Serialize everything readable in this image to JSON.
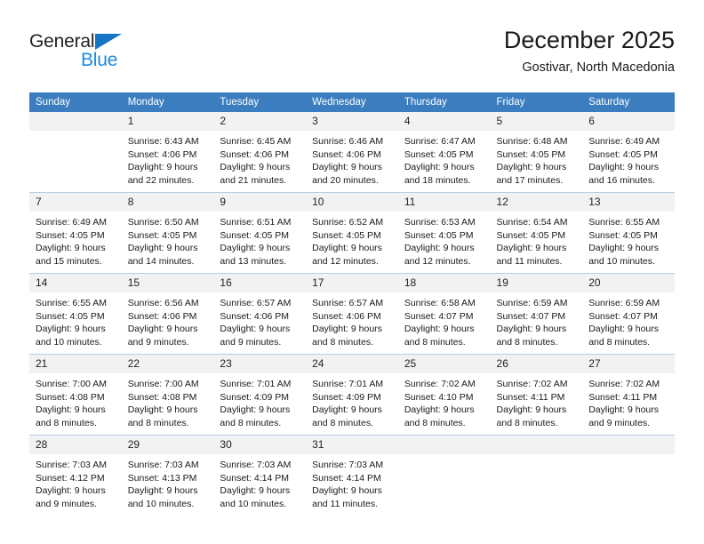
{
  "brand": {
    "name_top": "General",
    "name_bottom": "Blue",
    "accent_color": "#1b8ae0",
    "triangle_color": "#1574c4",
    "triangle_icon": "triangle-icon"
  },
  "header": {
    "title": "December 2025",
    "subtitle": "Gostivar, North Macedonia"
  },
  "calendar": {
    "header_background": "#3b7dbf",
    "daynum_background": "#f2f2f2",
    "grid_line_color": "#b7cde2",
    "weekdays": [
      "Sunday",
      "Monday",
      "Tuesday",
      "Wednesday",
      "Thursday",
      "Friday",
      "Saturday"
    ],
    "weeks": [
      [
        {
          "day": "",
          "empty": true,
          "sunrise": "",
          "sunset": "",
          "daylight_line1": "",
          "daylight_line2": ""
        },
        {
          "day": "1",
          "empty": false,
          "sunrise": "Sunrise: 6:43 AM",
          "sunset": "Sunset: 4:06 PM",
          "daylight_line1": "Daylight: 9 hours",
          "daylight_line2": "and 22 minutes."
        },
        {
          "day": "2",
          "empty": false,
          "sunrise": "Sunrise: 6:45 AM",
          "sunset": "Sunset: 4:06 PM",
          "daylight_line1": "Daylight: 9 hours",
          "daylight_line2": "and 21 minutes."
        },
        {
          "day": "3",
          "empty": false,
          "sunrise": "Sunrise: 6:46 AM",
          "sunset": "Sunset: 4:06 PM",
          "daylight_line1": "Daylight: 9 hours",
          "daylight_line2": "and 20 minutes."
        },
        {
          "day": "4",
          "empty": false,
          "sunrise": "Sunrise: 6:47 AM",
          "sunset": "Sunset: 4:05 PM",
          "daylight_line1": "Daylight: 9 hours",
          "daylight_line2": "and 18 minutes."
        },
        {
          "day": "5",
          "empty": false,
          "sunrise": "Sunrise: 6:48 AM",
          "sunset": "Sunset: 4:05 PM",
          "daylight_line1": "Daylight: 9 hours",
          "daylight_line2": "and 17 minutes."
        },
        {
          "day": "6",
          "empty": false,
          "sunrise": "Sunrise: 6:49 AM",
          "sunset": "Sunset: 4:05 PM",
          "daylight_line1": "Daylight: 9 hours",
          "daylight_line2": "and 16 minutes."
        }
      ],
      [
        {
          "day": "7",
          "empty": false,
          "sunrise": "Sunrise: 6:49 AM",
          "sunset": "Sunset: 4:05 PM",
          "daylight_line1": "Daylight: 9 hours",
          "daylight_line2": "and 15 minutes."
        },
        {
          "day": "8",
          "empty": false,
          "sunrise": "Sunrise: 6:50 AM",
          "sunset": "Sunset: 4:05 PM",
          "daylight_line1": "Daylight: 9 hours",
          "daylight_line2": "and 14 minutes."
        },
        {
          "day": "9",
          "empty": false,
          "sunrise": "Sunrise: 6:51 AM",
          "sunset": "Sunset: 4:05 PM",
          "daylight_line1": "Daylight: 9 hours",
          "daylight_line2": "and 13 minutes."
        },
        {
          "day": "10",
          "empty": false,
          "sunrise": "Sunrise: 6:52 AM",
          "sunset": "Sunset: 4:05 PM",
          "daylight_line1": "Daylight: 9 hours",
          "daylight_line2": "and 12 minutes."
        },
        {
          "day": "11",
          "empty": false,
          "sunrise": "Sunrise: 6:53 AM",
          "sunset": "Sunset: 4:05 PM",
          "daylight_line1": "Daylight: 9 hours",
          "daylight_line2": "and 12 minutes."
        },
        {
          "day": "12",
          "empty": false,
          "sunrise": "Sunrise: 6:54 AM",
          "sunset": "Sunset: 4:05 PM",
          "daylight_line1": "Daylight: 9 hours",
          "daylight_line2": "and 11 minutes."
        },
        {
          "day": "13",
          "empty": false,
          "sunrise": "Sunrise: 6:55 AM",
          "sunset": "Sunset: 4:05 PM",
          "daylight_line1": "Daylight: 9 hours",
          "daylight_line2": "and 10 minutes."
        }
      ],
      [
        {
          "day": "14",
          "empty": false,
          "sunrise": "Sunrise: 6:55 AM",
          "sunset": "Sunset: 4:05 PM",
          "daylight_line1": "Daylight: 9 hours",
          "daylight_line2": "and 10 minutes."
        },
        {
          "day": "15",
          "empty": false,
          "sunrise": "Sunrise: 6:56 AM",
          "sunset": "Sunset: 4:06 PM",
          "daylight_line1": "Daylight: 9 hours",
          "daylight_line2": "and 9 minutes."
        },
        {
          "day": "16",
          "empty": false,
          "sunrise": "Sunrise: 6:57 AM",
          "sunset": "Sunset: 4:06 PM",
          "daylight_line1": "Daylight: 9 hours",
          "daylight_line2": "and 9 minutes."
        },
        {
          "day": "17",
          "empty": false,
          "sunrise": "Sunrise: 6:57 AM",
          "sunset": "Sunset: 4:06 PM",
          "daylight_line1": "Daylight: 9 hours",
          "daylight_line2": "and 8 minutes."
        },
        {
          "day": "18",
          "empty": false,
          "sunrise": "Sunrise: 6:58 AM",
          "sunset": "Sunset: 4:07 PM",
          "daylight_line1": "Daylight: 9 hours",
          "daylight_line2": "and 8 minutes."
        },
        {
          "day": "19",
          "empty": false,
          "sunrise": "Sunrise: 6:59 AM",
          "sunset": "Sunset: 4:07 PM",
          "daylight_line1": "Daylight: 9 hours",
          "daylight_line2": "and 8 minutes."
        },
        {
          "day": "20",
          "empty": false,
          "sunrise": "Sunrise: 6:59 AM",
          "sunset": "Sunset: 4:07 PM",
          "daylight_line1": "Daylight: 9 hours",
          "daylight_line2": "and 8 minutes."
        }
      ],
      [
        {
          "day": "21",
          "empty": false,
          "sunrise": "Sunrise: 7:00 AM",
          "sunset": "Sunset: 4:08 PM",
          "daylight_line1": "Daylight: 9 hours",
          "daylight_line2": "and 8 minutes."
        },
        {
          "day": "22",
          "empty": false,
          "sunrise": "Sunrise: 7:00 AM",
          "sunset": "Sunset: 4:08 PM",
          "daylight_line1": "Daylight: 9 hours",
          "daylight_line2": "and 8 minutes."
        },
        {
          "day": "23",
          "empty": false,
          "sunrise": "Sunrise: 7:01 AM",
          "sunset": "Sunset: 4:09 PM",
          "daylight_line1": "Daylight: 9 hours",
          "daylight_line2": "and 8 minutes."
        },
        {
          "day": "24",
          "empty": false,
          "sunrise": "Sunrise: 7:01 AM",
          "sunset": "Sunset: 4:09 PM",
          "daylight_line1": "Daylight: 9 hours",
          "daylight_line2": "and 8 minutes."
        },
        {
          "day": "25",
          "empty": false,
          "sunrise": "Sunrise: 7:02 AM",
          "sunset": "Sunset: 4:10 PM",
          "daylight_line1": "Daylight: 9 hours",
          "daylight_line2": "and 8 minutes."
        },
        {
          "day": "26",
          "empty": false,
          "sunrise": "Sunrise: 7:02 AM",
          "sunset": "Sunset: 4:11 PM",
          "daylight_line1": "Daylight: 9 hours",
          "daylight_line2": "and 8 minutes."
        },
        {
          "day": "27",
          "empty": false,
          "sunrise": "Sunrise: 7:02 AM",
          "sunset": "Sunset: 4:11 PM",
          "daylight_line1": "Daylight: 9 hours",
          "daylight_line2": "and 9 minutes."
        }
      ],
      [
        {
          "day": "28",
          "empty": false,
          "sunrise": "Sunrise: 7:03 AM",
          "sunset": "Sunset: 4:12 PM",
          "daylight_line1": "Daylight: 9 hours",
          "daylight_line2": "and 9 minutes."
        },
        {
          "day": "29",
          "empty": false,
          "sunrise": "Sunrise: 7:03 AM",
          "sunset": "Sunset: 4:13 PM",
          "daylight_line1": "Daylight: 9 hours",
          "daylight_line2": "and 10 minutes."
        },
        {
          "day": "30",
          "empty": false,
          "sunrise": "Sunrise: 7:03 AM",
          "sunset": "Sunset: 4:14 PM",
          "daylight_line1": "Daylight: 9 hours",
          "daylight_line2": "and 10 minutes."
        },
        {
          "day": "31",
          "empty": false,
          "sunrise": "Sunrise: 7:03 AM",
          "sunset": "Sunset: 4:14 PM",
          "daylight_line1": "Daylight: 9 hours",
          "daylight_line2": "and 11 minutes."
        },
        {
          "day": "",
          "empty": true,
          "sunrise": "",
          "sunset": "",
          "daylight_line1": "",
          "daylight_line2": ""
        },
        {
          "day": "",
          "empty": true,
          "sunrise": "",
          "sunset": "",
          "daylight_line1": "",
          "daylight_line2": ""
        },
        {
          "day": "",
          "empty": true,
          "sunrise": "",
          "sunset": "",
          "daylight_line1": "",
          "daylight_line2": ""
        }
      ]
    ]
  }
}
